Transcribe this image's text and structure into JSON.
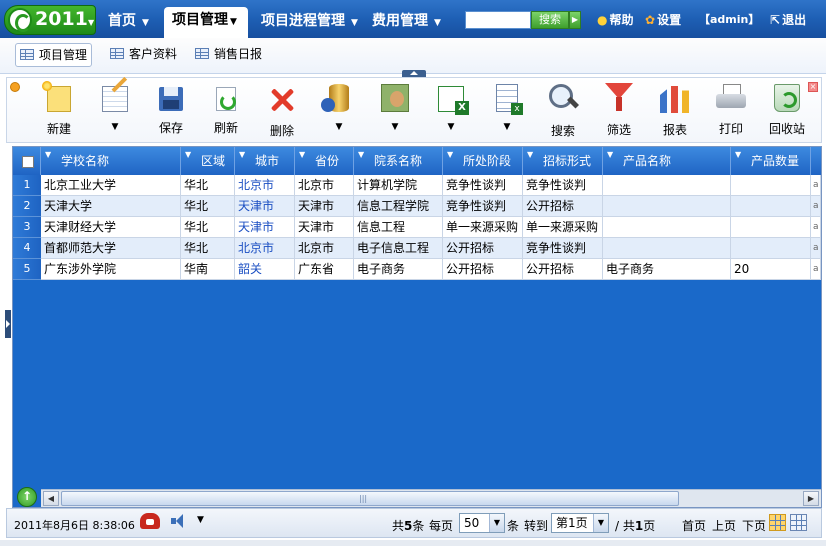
{
  "app": {
    "logo_year": "2011"
  },
  "nav": {
    "items": [
      {
        "label": "首页",
        "active": false
      },
      {
        "label": "项目管理",
        "active": true
      },
      {
        "label": "项目进程管理",
        "active": false
      },
      {
        "label": "费用管理",
        "active": false
      }
    ],
    "search_button": "搜索",
    "search_value": "",
    "help": "帮助",
    "settings": "设置",
    "user": "【admin】",
    "logout": "退出"
  },
  "tabs": [
    {
      "label": "项目管理",
      "active": true
    },
    {
      "label": "客户资料",
      "active": false
    },
    {
      "label": "销售日报",
      "active": false
    }
  ],
  "toolbar": {
    "items": [
      {
        "icon": "new-doc-icon",
        "label": "新建"
      },
      {
        "icon": "edit-icon",
        "label": "▼"
      },
      {
        "icon": "save-icon",
        "label": "保存"
      },
      {
        "icon": "refresh-icon",
        "label": "刷新"
      },
      {
        "icon": "delete-icon",
        "label": "删除"
      },
      {
        "icon": "database-icon",
        "label": "▼"
      },
      {
        "icon": "contacts-icon",
        "label": "▼"
      },
      {
        "icon": "excel-icon",
        "label": "▼"
      },
      {
        "icon": "export-icon",
        "label": "▼"
      },
      {
        "icon": "search-icon",
        "label": "搜索"
      },
      {
        "icon": "filter-icon",
        "label": "筛选"
      },
      {
        "icon": "report-icon",
        "label": "报表"
      },
      {
        "icon": "print-icon",
        "label": "打印"
      },
      {
        "icon": "recycle-bin-icon",
        "label": "回收站"
      }
    ]
  },
  "grid": {
    "columns": [
      "学校名称",
      "区域",
      "城市",
      "省份",
      "院系名称",
      "所处阶段",
      "招标形式",
      "产品名称",
      "产品数量"
    ],
    "rows": [
      {
        "num": "1",
        "cells": [
          "北京工业大学",
          "华北",
          "北京市",
          "北京市",
          "计算机学院",
          "竞争性谈判",
          "竞争性谈判",
          "",
          ""
        ]
      },
      {
        "num": "2",
        "cells": [
          "天津大学",
          "华北",
          "天津市",
          "天津市",
          "信息工程学院",
          "竞争性谈判",
          "公开招标",
          "",
          ""
        ]
      },
      {
        "num": "3",
        "cells": [
          "天津财经大学",
          "华北",
          "天津市",
          "天津市",
          "信息工程",
          "单一来源采购",
          "单一来源采购",
          "",
          ""
        ]
      },
      {
        "num": "4",
        "cells": [
          "首都师范大学",
          "华北",
          "北京市",
          "北京市",
          "电子信息工程",
          "公开招标",
          "竞争性谈判",
          "",
          ""
        ]
      },
      {
        "num": "5",
        "cells": [
          "广东涉外学院",
          "华南",
          "韶关",
          "广东省",
          "电子商务",
          "公开招标",
          "公开招标",
          "电子商务",
          "20"
        ]
      }
    ],
    "tail_glyph": "a"
  },
  "status": {
    "datetime": "2011年8月6日  8:38:06",
    "total_prefix": "共",
    "total_count": "5",
    "total_suffix": "条",
    "per_page_label": "每页",
    "per_page_value": "50",
    "per_page_unit": "条",
    "goto_label": "转到",
    "goto_value": "第1页",
    "pages_label": "/ 共",
    "pages_count": "1",
    "pages_suffix": "页",
    "first": "首页",
    "prev": "上页",
    "next": "下页"
  }
}
